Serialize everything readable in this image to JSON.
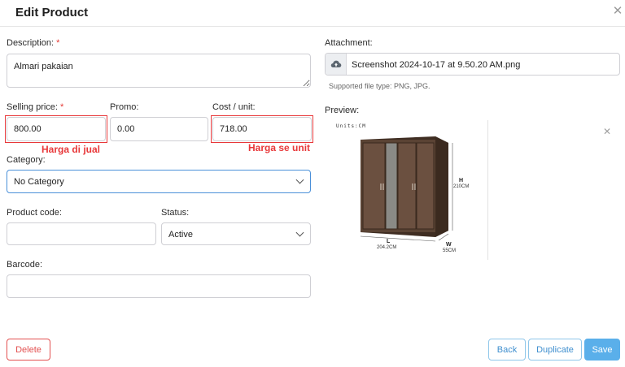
{
  "dialog": {
    "title": "Edit Product"
  },
  "description": {
    "label": "Description:",
    "required_mark": "*",
    "value": "Almari pakaian"
  },
  "selling_price": {
    "label": "Selling price:",
    "required_mark": "*",
    "value": "800.00"
  },
  "promo": {
    "label": "Promo:",
    "value": "0.00"
  },
  "cost_unit": {
    "label": "Cost / unit:",
    "value": "718.00"
  },
  "annotations": {
    "selling_note": "Harga di jual",
    "cost_note": "Harga se unit"
  },
  "category": {
    "label": "Category:",
    "selected": "No Category"
  },
  "product_code": {
    "label": "Product code:",
    "value": ""
  },
  "status": {
    "label": "Status:",
    "selected": "Active"
  },
  "barcode": {
    "label": "Barcode:",
    "value": ""
  },
  "attachment": {
    "label": "Attachment:",
    "filename": "Screenshot 2024-10-17 at 9.50.20 AM.png",
    "supported_note": "Supported file type: PNG, JPG."
  },
  "preview": {
    "label": "Preview:",
    "units_label": "Units:CM",
    "h_label": "H",
    "h_value": "210CM",
    "l_label": "L",
    "l_value": "204.2CM",
    "w_label": "W",
    "w_value": "55CM"
  },
  "buttons": {
    "delete": "Delete",
    "back": "Back",
    "duplicate": "Duplicate",
    "save": "Save"
  },
  "colors": {
    "annotation_red": "#e8383a",
    "focus_blue": "#4a90d9",
    "save_blue": "#5aafea",
    "outline_blue": "#8ec6ea",
    "delete_red": "#e35050"
  }
}
